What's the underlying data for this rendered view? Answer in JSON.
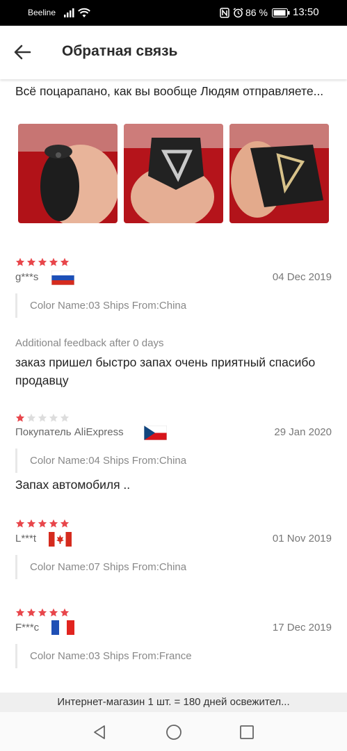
{
  "status_bar": {
    "carrier": "Beeline",
    "battery": "86 %",
    "time": "13:50",
    "icons": [
      "signal-icon",
      "wifi-icon",
      "nfc-icon",
      "alarm-icon",
      "battery-icon"
    ]
  },
  "header": {
    "title": "Обратная связь",
    "back_icon": "back-arrow-icon"
  },
  "reviews": [
    {
      "text": "Всё поцарапано, как вы вообще Людям отправляете...",
      "photos": [
        "photo-1",
        "photo-2",
        "photo-3"
      ]
    },
    {
      "rating": 5,
      "author": "g***s",
      "flag": "russia",
      "date": "04 Dec 2019",
      "sku": "Color Name:03 Ships From:China",
      "additional_label": "Additional feedback after 0 days",
      "additional_text": "заказ пришел быстро запах очень приятный спасибо продавцу"
    },
    {
      "rating": 1,
      "author": "Покупатель AliExpress",
      "flag": "czech",
      "date": "29 Jan 2020",
      "sku": "Color Name:04 Ships From:China",
      "text": "Запах автомобиля .."
    },
    {
      "rating": 5,
      "author": "L***t",
      "flag": "canada",
      "date": "01 Nov 2019",
      "sku": "Color Name:07 Ships From:China"
    },
    {
      "rating": 5,
      "author": "F***c",
      "flag": "france",
      "date": "17 Dec 2019",
      "sku": "Color Name:03 Ships From:France"
    }
  ],
  "bottom_banner": "Интернет-магазин 1 шт. = 180 дней освежител...",
  "colors": {
    "star_active": "#e8464b",
    "star_inactive": "#dddddd"
  },
  "nav": [
    "back-triangle-icon",
    "home-circle-icon",
    "recents-square-icon"
  ]
}
